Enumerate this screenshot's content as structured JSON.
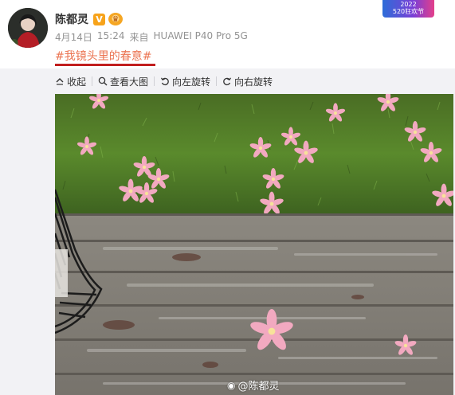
{
  "post": {
    "username": "陈都灵",
    "vip_badge": "V",
    "date": "4月14日",
    "time": "15:24",
    "source_prefix": "来自",
    "source_device": "HUAWEI P40 Pro 5G",
    "hashtag": "#我镜头里的春意#"
  },
  "promo_banner": {
    "line1": "2022",
    "line2": "520狂欢节"
  },
  "toolbar": {
    "collapse_label": "收起",
    "view_large_label": "查看大图",
    "rotate_left_label": "向左旋转",
    "rotate_right_label": "向右旋转"
  },
  "image": {
    "watermark_text": "@陈都灵"
  },
  "colors": {
    "hashtag": "#eb7350",
    "underline": "#c11e1e",
    "vip_badge": "#f7a31b",
    "panel_bg": "#f2f2f5"
  }
}
